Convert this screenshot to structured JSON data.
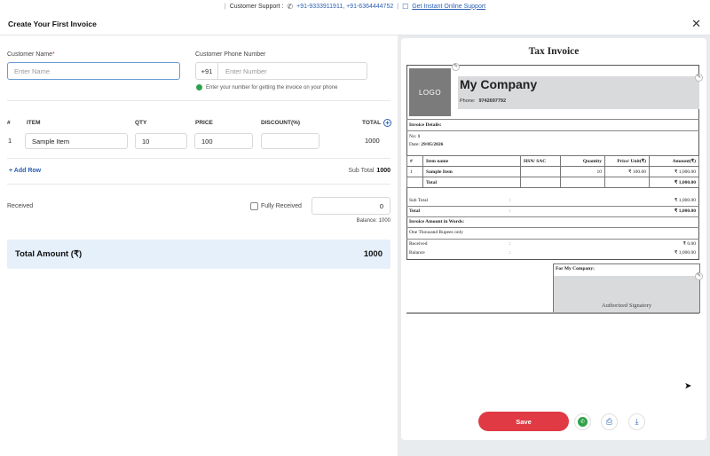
{
  "topbar": {
    "support_label": "Customer Support :",
    "phones": "+91-9333911911, +91-6364444752",
    "online_link": "Get Instant Online Support"
  },
  "header": {
    "title": "Create Your First Invoice",
    "close": "✕"
  },
  "form": {
    "customer_name_label": "Customer Name",
    "customer_name_required": "*",
    "customer_name_placeholder": "Enter Name",
    "phone_label": "Customer Phone Number",
    "country_code": "+91",
    "phone_placeholder": "Enter Number",
    "phone_hint": "Enter your number for getting the invoice on your phone"
  },
  "table": {
    "headers": {
      "num": "#",
      "item": "ITEM",
      "qty": "QTY",
      "price": "PRICE",
      "discount": "DISCOUNT(%)",
      "total": "TOTAL"
    },
    "rows": [
      {
        "num": "1",
        "item": "Sample Item",
        "qty": "10",
        "price": "100",
        "discount": "",
        "total": "1000"
      }
    ],
    "add_row": "+ Add Row",
    "subtotal_label": "Sub Total",
    "subtotal_value": "1000"
  },
  "payment": {
    "received_label": "Received",
    "fully_received_label": "Fully Received",
    "received_value": "0",
    "balance_text": "Balance: 1000"
  },
  "total": {
    "label": "Total Amount (₹)",
    "value": "1000"
  },
  "invoice": {
    "title": "Tax Invoice",
    "logo": "LOGO",
    "company": "My Company",
    "phone_label": "Phone:",
    "phone_value": "9742697792",
    "details_title": "Invoice Details:",
    "no_label": "No:",
    "no_value": "1",
    "date_label": "Date:",
    "date_value": "29/05/2026",
    "cols": {
      "num": "#",
      "item": "Item name",
      "hsn": "HSN/ SAC",
      "qty": "Quantity",
      "price": "Price/ Unit(₹)",
      "amount": "Amount(₹)"
    },
    "row": {
      "num": "1",
      "item": "Sample Item",
      "hsn": "",
      "qty": "10",
      "price": "₹ 100.00",
      "amount": "₹ 1,000.00"
    },
    "total_row_label": "Total",
    "total_row_amount": "₹ 1,000.00",
    "subtotal_label": "Sub Total",
    "subtotal_value": "₹ 1,000.00",
    "total_label": "Total",
    "total_value": "₹ 1,000.00",
    "colon": ":",
    "words_title": "Invoice Amount in Words:",
    "words_value": "One Thousand Rupees only",
    "received_label": "Received",
    "received_value": "₹ 0.00",
    "balance_label": "Balance",
    "balance_value": "₹ 1,000.00",
    "sig_title": "For My Company:",
    "sig_text": "Authorized Signatory"
  },
  "actions": {
    "save": "Save"
  },
  "colors": {
    "accent": "#2b5fb3",
    "save": "#e03a44",
    "total_bg": "#e5f0fb",
    "whatsapp": "#2ea24a"
  }
}
